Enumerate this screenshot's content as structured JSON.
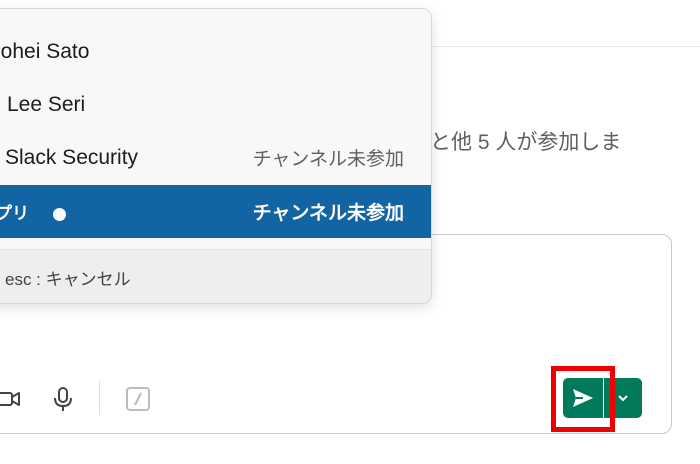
{
  "background": {
    "message_text": "と他 5 人が参加しま"
  },
  "mention_menu": {
    "items": [
      {
        "name": "nohei Sato",
        "meta": ""
      },
      {
        "name": "Lee Seri",
        "meta": ""
      },
      {
        "name": "Slack Security",
        "meta": "チャンネル未参加"
      },
      {
        "name": "プリ",
        "meta": "チャンネル未参加",
        "selected": true
      }
    ],
    "footer_hint": "esc : キャンセル"
  },
  "composer": {
    "toolbar_icons": [
      "video-icon",
      "microphone-icon",
      "slash-command-icon"
    ],
    "send_icon": "send-icon",
    "send_options_icon": "chevron-down-icon"
  },
  "colors": {
    "selected_row": "#1264a3",
    "send_button": "#007a5a",
    "highlight": "#ee0000"
  }
}
